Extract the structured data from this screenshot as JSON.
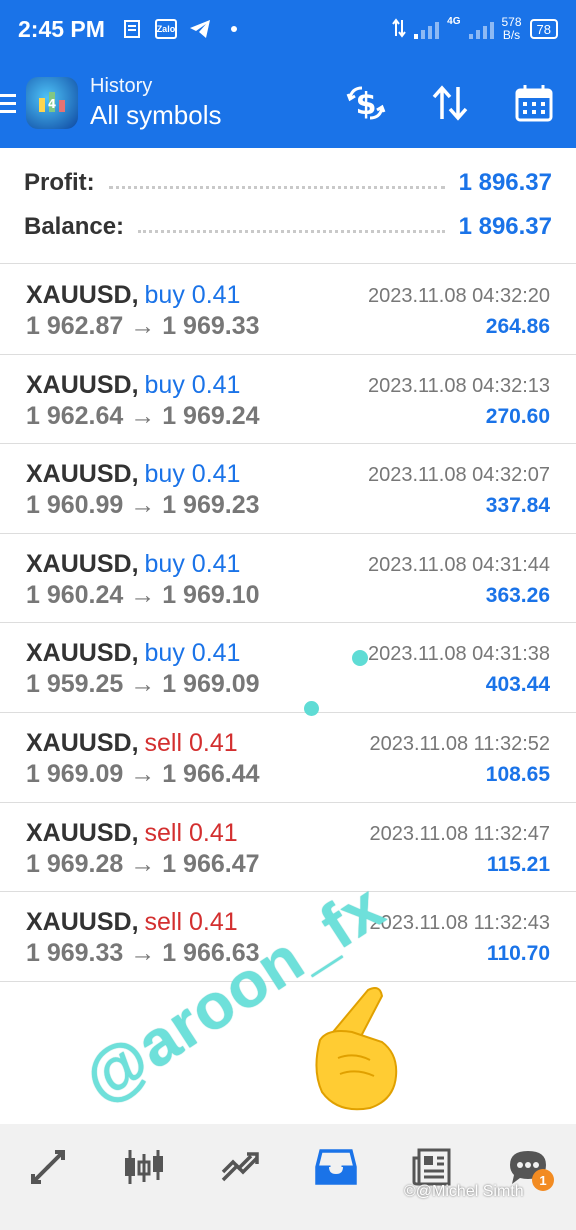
{
  "status_bar": {
    "time": "2:45 PM",
    "speed_value": "578",
    "speed_unit": "B/s",
    "network": "4G",
    "battery": "78"
  },
  "app_bar": {
    "subtitle": "History",
    "title": "All symbols",
    "icons": [
      "deposit-dollar-icon",
      "sort-icon",
      "calendar-icon"
    ]
  },
  "summary": {
    "profit_label": "Profit:",
    "profit_value": "1 896.37",
    "balance_label": "Balance:",
    "balance_value": "1 896.37"
  },
  "trades": [
    {
      "symbol": "XAUUSD",
      "type": "buy 0.41",
      "side": "buy",
      "prices": "1 962.87 → 1 969.33",
      "time": "2023.11.08 04:32:20",
      "profit": "264.86"
    },
    {
      "symbol": "XAUUSD",
      "type": "buy 0.41",
      "side": "buy",
      "prices": "1 962.64 → 1 969.24",
      "time": "2023.11.08 04:32:13",
      "profit": "270.60"
    },
    {
      "symbol": "XAUUSD",
      "type": "buy 0.41",
      "side": "buy",
      "prices": "1 960.99 → 1 969.23",
      "time": "2023.11.08 04:32:07",
      "profit": "337.84"
    },
    {
      "symbol": "XAUUSD",
      "type": "buy 0.41",
      "side": "buy",
      "prices": "1 960.24 → 1 969.10",
      "time": "2023.11.08 04:31:44",
      "profit": "363.26"
    },
    {
      "symbol": "XAUUSD",
      "type": "buy 0.41",
      "side": "buy",
      "prices": "1 959.25 → 1 969.09",
      "time": "2023.11.08 04:31:38",
      "profit": "403.44"
    },
    {
      "symbol": "XAUUSD",
      "type": "sell 0.41",
      "side": "sell",
      "prices": "1 969.09 → 1 966.44",
      "time": "2023.11.08 11:32:52",
      "profit": "108.65"
    },
    {
      "symbol": "XAUUSD",
      "type": "sell 0.41",
      "side": "sell",
      "prices": "1 969.28 → 1 966.47",
      "time": "2023.11.08 11:32:47",
      "profit": "115.21"
    },
    {
      "symbol": "XAUUSD",
      "type": "sell 0.41",
      "side": "sell",
      "prices": "1 969.33 → 1 966.63",
      "time": "2023.11.08 11:32:43",
      "profit": "110.70"
    }
  ],
  "watermark": "@aroon_fx",
  "credit": "©@Michel Simth",
  "bottom_nav": {
    "items": [
      "quotes-icon",
      "chart-icon",
      "trade-icon",
      "history-icon",
      "news-icon",
      "messages-icon"
    ],
    "messages_badge": "1"
  },
  "colors": {
    "accent": "#1a73e8",
    "buy": "#1a73e8",
    "sell": "#d32f2f",
    "watermark": "#6ee0da"
  }
}
